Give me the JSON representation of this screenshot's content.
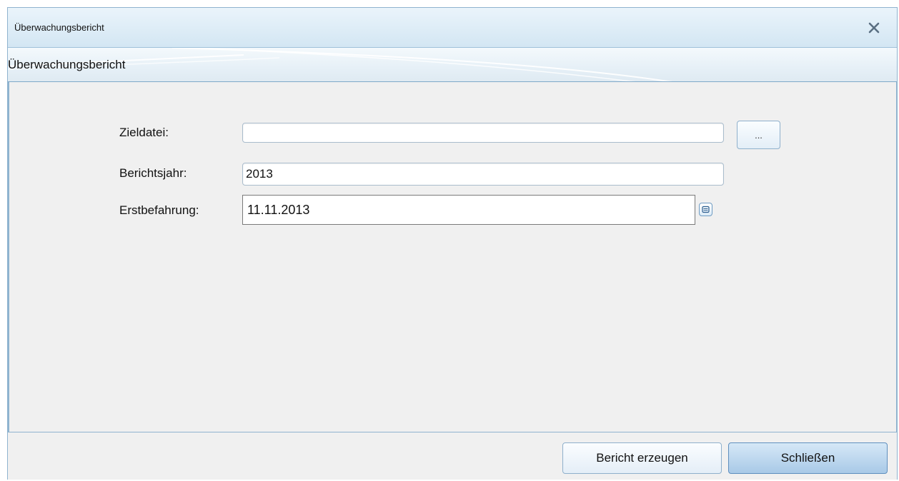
{
  "window": {
    "title": "Überwachungsbericht"
  },
  "banner": {
    "title": "Überwachungsbericht"
  },
  "form": {
    "zieldatei": {
      "label": "Zieldatei:",
      "value": "",
      "browse_label": "..."
    },
    "berichtsjahr": {
      "label": "Berichtsjahr:",
      "value": "2013"
    },
    "erstbefahrung": {
      "label": "Erstbefahrung:",
      "value": "11.11.2013"
    }
  },
  "footer": {
    "generate_label": "Bericht erzeugen",
    "close_label": "Schließen"
  },
  "icons": {
    "close": "close-icon",
    "date_picker": "calendar-icon"
  },
  "colors": {
    "titlebar": "#d3e6f3",
    "accent_border": "#8fb3cf",
    "primary_button": "#a8c9e7"
  }
}
